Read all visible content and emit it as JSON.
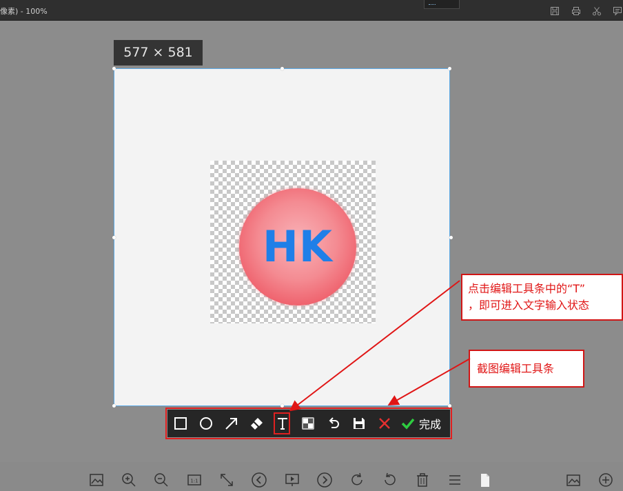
{
  "window": {
    "title": "像素) - 100%"
  },
  "screenshot": {
    "size_label": "577 × 581",
    "logo_text": "HK"
  },
  "toolbar": {
    "tools": [
      "rectangle-icon",
      "ellipse-icon",
      "arrow-icon",
      "brush-icon",
      "text-icon",
      "mosaic-icon",
      "undo-icon",
      "save-icon",
      "cancel-icon"
    ],
    "done_label": "完成"
  },
  "annotations": {
    "text_tool_note_line1": "点击编辑工具条中的“T”",
    "text_tool_note_line2": "，即可进入文字输入状态",
    "toolbar_note": "截图编辑工具条",
    "accent_color": "#e01515"
  },
  "bottom_toolbar": {
    "icons": [
      "image-icon",
      "zoom-in-icon",
      "zoom-out-icon",
      "actual-size-icon",
      "fit-icon",
      "prev-icon",
      "slideshow-icon",
      "next-icon",
      "rotate-cw-icon",
      "rotate-ccw-icon",
      "delete-icon",
      "menu-icon",
      "file-icon",
      "gallery-icon",
      "add-icon"
    ],
    "actual_size_label": "1:1"
  }
}
